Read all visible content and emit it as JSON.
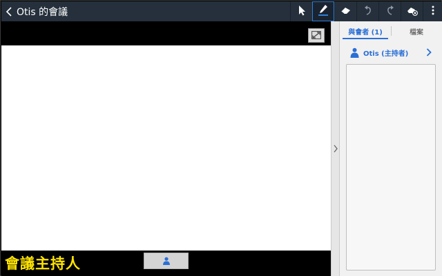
{
  "header": {
    "title": "Otis 的會議",
    "back_icon": "chevron-left-icon",
    "tools": [
      {
        "name": "pointer-tool-button",
        "icon": "cursor-arrow-icon",
        "active": false
      },
      {
        "name": "pen-tool-button",
        "icon": "pen-icon",
        "active": true
      },
      {
        "name": "eraser-tool-button",
        "icon": "eraser-icon",
        "active": false
      },
      {
        "name": "undo-button",
        "icon": "undo-icon",
        "active": false
      },
      {
        "name": "redo-button",
        "icon": "redo-icon",
        "active": false
      },
      {
        "name": "clear-drawing-button",
        "icon": "eraser-clear-icon",
        "active": false
      },
      {
        "name": "overflow-menu-button",
        "icon": "more-vertical-icon",
        "active": false
      }
    ]
  },
  "main": {
    "host_caption": "會議主持人",
    "fullscreen_icon": "expand-icon",
    "presenter_icon": "person-icon"
  },
  "panel": {
    "tabs": [
      {
        "label": "與會者 (1)",
        "active": true
      },
      {
        "label": "檔案",
        "active": false
      }
    ],
    "participants": [
      {
        "name": "Otis (主持者)",
        "icon": "person-icon"
      }
    ]
  },
  "colors": {
    "topbar": "#25303c",
    "accent": "#2a6fd6",
    "caption": "#ffe400",
    "active_tool_border": "#2f7fd8"
  }
}
